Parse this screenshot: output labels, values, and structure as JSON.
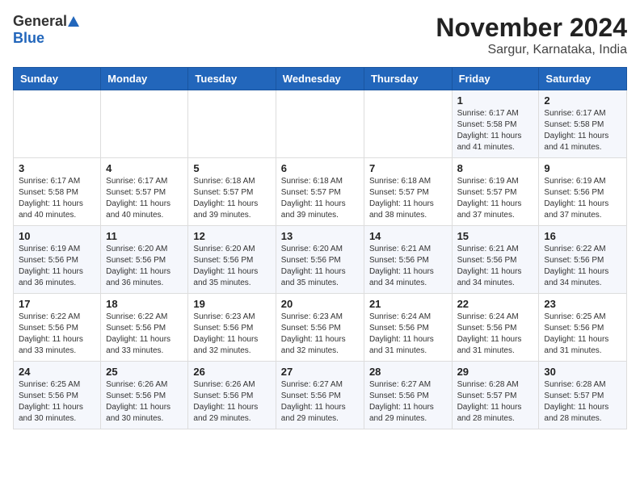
{
  "logo": {
    "general": "General",
    "blue": "Blue"
  },
  "title": "November 2024",
  "subtitle": "Sargur, Karnataka, India",
  "days_of_week": [
    "Sunday",
    "Monday",
    "Tuesday",
    "Wednesday",
    "Thursday",
    "Friday",
    "Saturday"
  ],
  "weeks": [
    [
      {
        "day": "",
        "info": ""
      },
      {
        "day": "",
        "info": ""
      },
      {
        "day": "",
        "info": ""
      },
      {
        "day": "",
        "info": ""
      },
      {
        "day": "",
        "info": ""
      },
      {
        "day": "1",
        "info": "Sunrise: 6:17 AM\nSunset: 5:58 PM\nDaylight: 11 hours and 41 minutes."
      },
      {
        "day": "2",
        "info": "Sunrise: 6:17 AM\nSunset: 5:58 PM\nDaylight: 11 hours and 41 minutes."
      }
    ],
    [
      {
        "day": "3",
        "info": "Sunrise: 6:17 AM\nSunset: 5:58 PM\nDaylight: 11 hours and 40 minutes."
      },
      {
        "day": "4",
        "info": "Sunrise: 6:17 AM\nSunset: 5:57 PM\nDaylight: 11 hours and 40 minutes."
      },
      {
        "day": "5",
        "info": "Sunrise: 6:18 AM\nSunset: 5:57 PM\nDaylight: 11 hours and 39 minutes."
      },
      {
        "day": "6",
        "info": "Sunrise: 6:18 AM\nSunset: 5:57 PM\nDaylight: 11 hours and 39 minutes."
      },
      {
        "day": "7",
        "info": "Sunrise: 6:18 AM\nSunset: 5:57 PM\nDaylight: 11 hours and 38 minutes."
      },
      {
        "day": "8",
        "info": "Sunrise: 6:19 AM\nSunset: 5:57 PM\nDaylight: 11 hours and 37 minutes."
      },
      {
        "day": "9",
        "info": "Sunrise: 6:19 AM\nSunset: 5:56 PM\nDaylight: 11 hours and 37 minutes."
      }
    ],
    [
      {
        "day": "10",
        "info": "Sunrise: 6:19 AM\nSunset: 5:56 PM\nDaylight: 11 hours and 36 minutes."
      },
      {
        "day": "11",
        "info": "Sunrise: 6:20 AM\nSunset: 5:56 PM\nDaylight: 11 hours and 36 minutes."
      },
      {
        "day": "12",
        "info": "Sunrise: 6:20 AM\nSunset: 5:56 PM\nDaylight: 11 hours and 35 minutes."
      },
      {
        "day": "13",
        "info": "Sunrise: 6:20 AM\nSunset: 5:56 PM\nDaylight: 11 hours and 35 minutes."
      },
      {
        "day": "14",
        "info": "Sunrise: 6:21 AM\nSunset: 5:56 PM\nDaylight: 11 hours and 34 minutes."
      },
      {
        "day": "15",
        "info": "Sunrise: 6:21 AM\nSunset: 5:56 PM\nDaylight: 11 hours and 34 minutes."
      },
      {
        "day": "16",
        "info": "Sunrise: 6:22 AM\nSunset: 5:56 PM\nDaylight: 11 hours and 34 minutes."
      }
    ],
    [
      {
        "day": "17",
        "info": "Sunrise: 6:22 AM\nSunset: 5:56 PM\nDaylight: 11 hours and 33 minutes."
      },
      {
        "day": "18",
        "info": "Sunrise: 6:22 AM\nSunset: 5:56 PM\nDaylight: 11 hours and 33 minutes."
      },
      {
        "day": "19",
        "info": "Sunrise: 6:23 AM\nSunset: 5:56 PM\nDaylight: 11 hours and 32 minutes."
      },
      {
        "day": "20",
        "info": "Sunrise: 6:23 AM\nSunset: 5:56 PM\nDaylight: 11 hours and 32 minutes."
      },
      {
        "day": "21",
        "info": "Sunrise: 6:24 AM\nSunset: 5:56 PM\nDaylight: 11 hours and 31 minutes."
      },
      {
        "day": "22",
        "info": "Sunrise: 6:24 AM\nSunset: 5:56 PM\nDaylight: 11 hours and 31 minutes."
      },
      {
        "day": "23",
        "info": "Sunrise: 6:25 AM\nSunset: 5:56 PM\nDaylight: 11 hours and 31 minutes."
      }
    ],
    [
      {
        "day": "24",
        "info": "Sunrise: 6:25 AM\nSunset: 5:56 PM\nDaylight: 11 hours and 30 minutes."
      },
      {
        "day": "25",
        "info": "Sunrise: 6:26 AM\nSunset: 5:56 PM\nDaylight: 11 hours and 30 minutes."
      },
      {
        "day": "26",
        "info": "Sunrise: 6:26 AM\nSunset: 5:56 PM\nDaylight: 11 hours and 29 minutes."
      },
      {
        "day": "27",
        "info": "Sunrise: 6:27 AM\nSunset: 5:56 PM\nDaylight: 11 hours and 29 minutes."
      },
      {
        "day": "28",
        "info": "Sunrise: 6:27 AM\nSunset: 5:56 PM\nDaylight: 11 hours and 29 minutes."
      },
      {
        "day": "29",
        "info": "Sunrise: 6:28 AM\nSunset: 5:57 PM\nDaylight: 11 hours and 28 minutes."
      },
      {
        "day": "30",
        "info": "Sunrise: 6:28 AM\nSunset: 5:57 PM\nDaylight: 11 hours and 28 minutes."
      }
    ]
  ]
}
